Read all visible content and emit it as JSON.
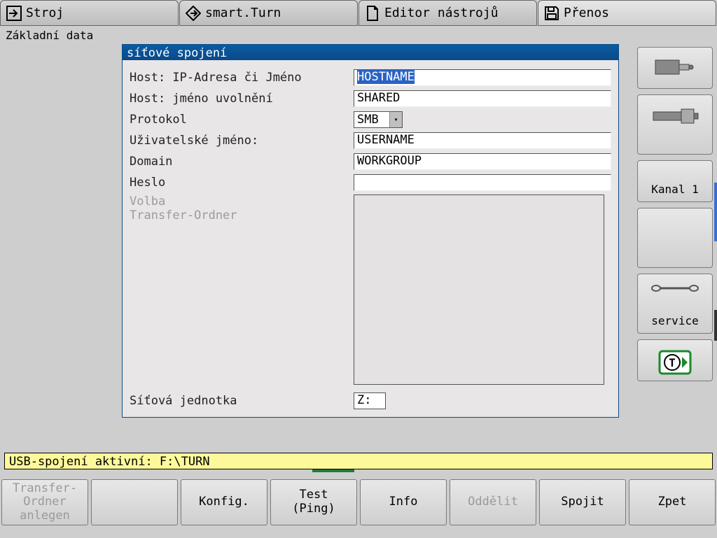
{
  "tabs": {
    "stroj": "Stroj",
    "smart": "smart.Turn",
    "editor": "Editor nástrojů",
    "prenos": "Přenos"
  },
  "subtitle": "Základní data",
  "dialog": {
    "title": "síťové spojení",
    "host_ip_label": "Host: IP-Adresa či Jméno",
    "host_ip_value": "HOSTNAME",
    "host_share_label": "Host: jméno uvolnění",
    "host_share_value": "SHARED",
    "protocol_label": "Protokol",
    "protocol_value": "SMB",
    "username_label": "Uživatelské jméno:",
    "username_value": "USERNAME",
    "domain_label": "Domain",
    "domain_value": "WORKGROUP",
    "password_label": "Heslo",
    "password_value": "",
    "option_label1": "Volba",
    "option_label2": "Transfer-Ordner",
    "drive_label": "Síťová jednotka",
    "drive_value": "Z:"
  },
  "right": {
    "kanal": "Kanal 1",
    "service": "service"
  },
  "status": "USB-spojení aktivní: F:\\TURN",
  "bottom": {
    "transfer1": "Transfer-",
    "transfer2": "Ordner",
    "transfer3": "anlegen",
    "konfig": "Konfig.",
    "test1": "Test",
    "test2": "(Ping)",
    "info": "Info",
    "oddelit": "Oddělit",
    "spojit": "Spojit",
    "zpet": "Zpet"
  }
}
